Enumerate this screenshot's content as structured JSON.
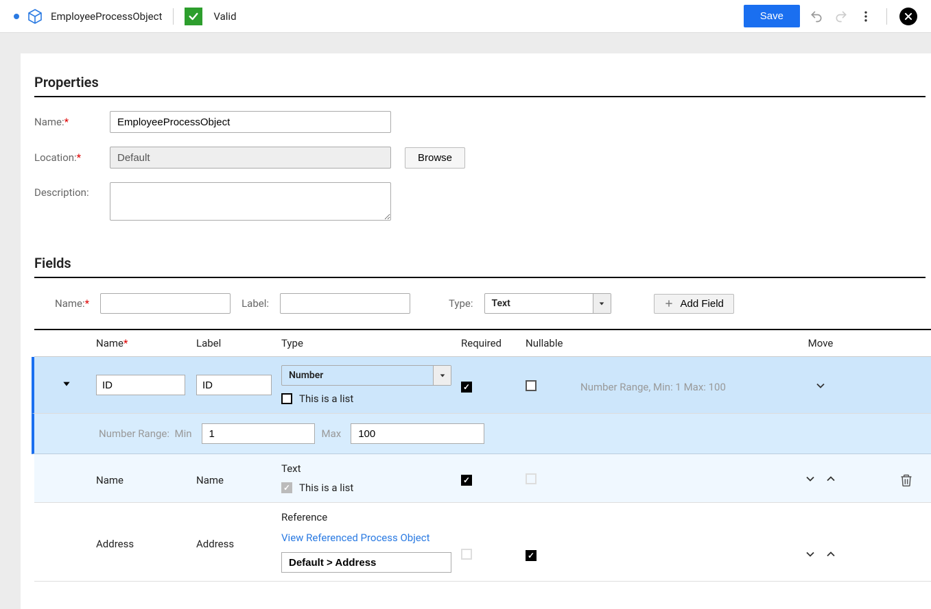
{
  "top": {
    "object_name": "EmployeeProcessObject",
    "valid_label": "Valid",
    "save_label": "Save"
  },
  "properties": {
    "title": "Properties",
    "name_label": "Name:",
    "name_value": "EmployeeProcessObject",
    "location_label": "Location:",
    "location_value": "Default",
    "browse_label": "Browse",
    "description_label": "Description:",
    "description_value": ""
  },
  "fields": {
    "title": "Fields",
    "newrow": {
      "name_label": "Name:",
      "label_label": "Label:",
      "type_label": "Type:",
      "type_value": "Text",
      "addfield_label": "Add Field"
    },
    "columns": {
      "name": "Name",
      "label": "Label",
      "type": "Type",
      "required": "Required",
      "nullable": "Nullable",
      "move": "Move"
    },
    "row_id": {
      "name": "ID",
      "label": "ID",
      "type": "Number",
      "is_list_label": "This is a list",
      "info": "Number Range, Min: 1 Max: 100",
      "range_label": "Number Range:",
      "min_label": "Min",
      "min_value": "1",
      "max_label": "Max",
      "max_value": "100"
    },
    "row_name": {
      "name": "Name",
      "label": "Name",
      "type": "Text",
      "is_list_label": "This is a list"
    },
    "row_address": {
      "name": "Address",
      "label": "Address",
      "type": "Reference",
      "view_ref_label": "View Referenced Process Object",
      "ref_path": "Default > Address"
    }
  }
}
